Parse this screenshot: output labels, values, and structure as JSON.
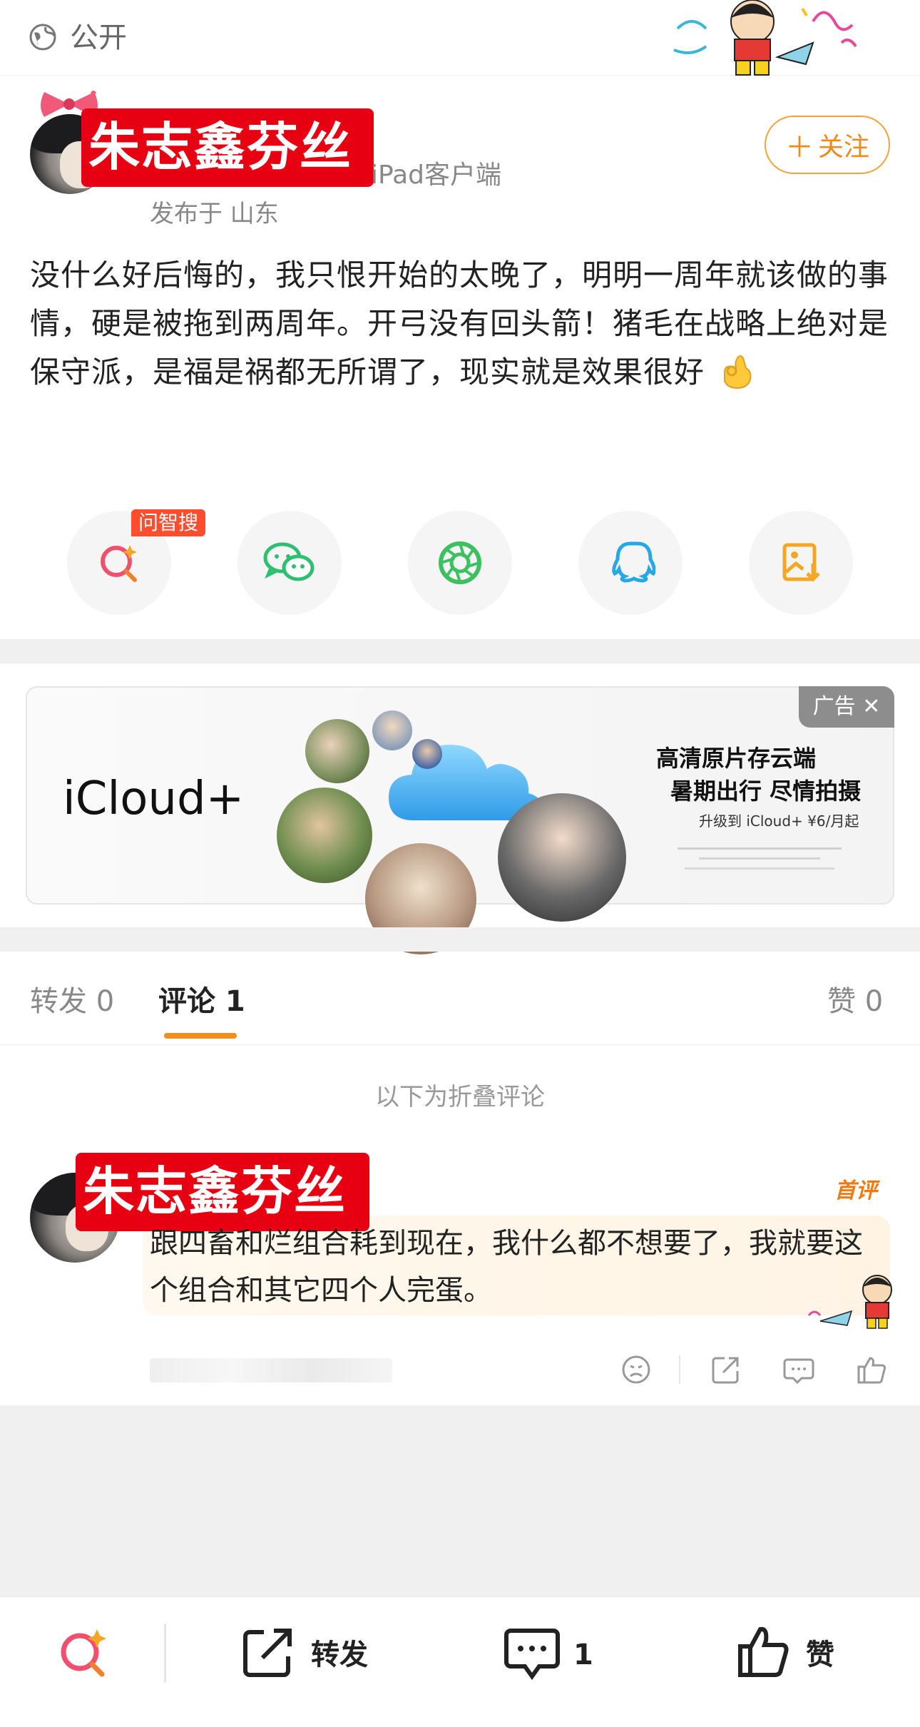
{
  "topbar": {
    "visibility": "公开",
    "visibility_icon": "globe-icon"
  },
  "post": {
    "author": "朱志鑫芬丝",
    "client": "iPad客户端",
    "location": "发布于 山东",
    "follow_label": "关注",
    "body": "没什么好后悔的，我只恨开始的太晚了，明明一周年就该做的事情，硬是被拖到两周年。开弓没有回头箭！猪毛在战略上绝对是保守派，是福是祸都无所谓了，现实就是效果很好",
    "body_emoji": "ok-hand-emoji"
  },
  "share": {
    "badge": "问智搜",
    "items": [
      "ai-search-icon",
      "wechat-icon",
      "moments-icon",
      "qq-icon",
      "save-image-icon"
    ]
  },
  "ad": {
    "label": "广告",
    "brand": "iCloud+",
    "line1": "高清原片存云端",
    "line2": "暑期出行 尽情拍摄",
    "line3": "升级到 iCloud+ ¥6/月起"
  },
  "tabs": {
    "repost": "转发 0",
    "comments": "评论 1",
    "likes": "赞 0"
  },
  "comments_section": {
    "folded_notice": "以下为折叠评论",
    "comment": {
      "author": "朱志鑫芬丝",
      "tag": "首评",
      "text": "跟四畜和烂组合耗到现在，我什么都不想要了，我就要这个组合和其它四个人完蛋。"
    }
  },
  "bottombar": {
    "repost_label": "转发",
    "comment_count": "1",
    "like_label": "赞"
  },
  "colors": {
    "accent_orange": "#f38d1c",
    "name_red": "#e60012",
    "badge_red": "#ff4d2e"
  }
}
